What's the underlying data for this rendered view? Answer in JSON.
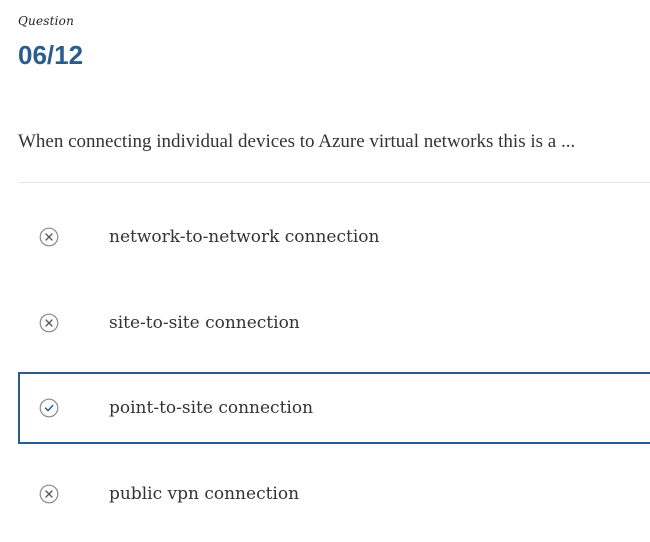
{
  "header": {
    "question_label": "Question",
    "counter": "06/12"
  },
  "question": {
    "text": "When connecting individual devices to Azure virtual networks this is a ..."
  },
  "options": [
    {
      "label": "network-to-network connection",
      "icon": "x-circle-icon",
      "selected": false
    },
    {
      "label": "site-to-site connection",
      "icon": "x-circle-icon",
      "selected": false
    },
    {
      "label": "point-to-site connection",
      "icon": "check-circle-icon",
      "selected": true
    },
    {
      "label": "public vpn connection",
      "icon": "x-circle-icon",
      "selected": false
    }
  ],
  "colors": {
    "accent": "#2a5d8f",
    "icon_gray": "#8a8a8a"
  }
}
